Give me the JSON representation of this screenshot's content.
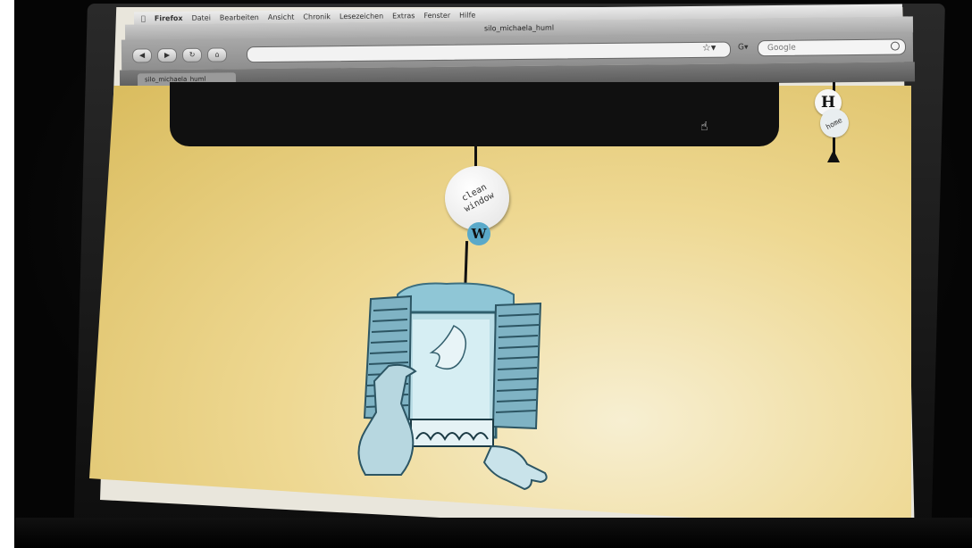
{
  "browser": {
    "menu": [
      "Firefox",
      "Datei",
      "Bearbeiten",
      "Ansicht",
      "Chronik",
      "Lesezeichen",
      "Extras",
      "Fenster",
      "Hilfe"
    ],
    "window_title": "silo_michaela_huml",
    "search_placeholder": "Google",
    "tab_label": "silo_michaela_huml"
  },
  "page": {
    "clean_window_label": "clean window",
    "w_label": "W",
    "h_label": "H",
    "home_label": "home"
  },
  "colors": {
    "page_bg": "#e9d485",
    "panel": "#101010",
    "window_blue": "#8fc6d6",
    "tag_blue": "#5aa9c9"
  }
}
